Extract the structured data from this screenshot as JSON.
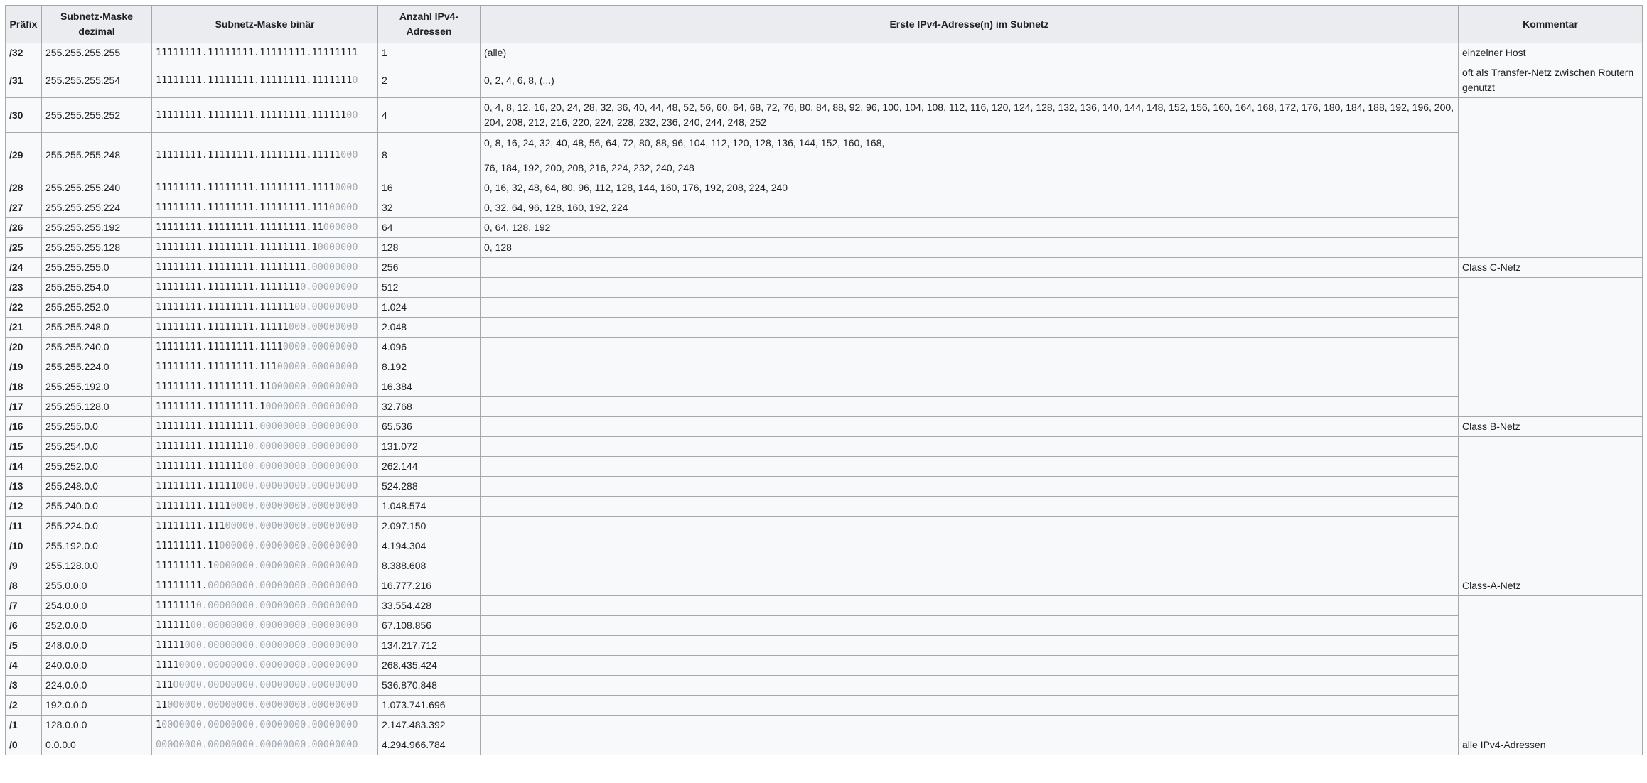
{
  "headers": {
    "prefix": "Präfix",
    "mask_dec": "Subnetz-Maske dezimal",
    "mask_bin": "Subnetz-Maske binär",
    "count": "Anzahl IPv4-Adressen",
    "first": "Erste IPv4-Adresse(n) im Subnetz",
    "comment": "Kommentar"
  },
  "rows": [
    {
      "prefix": "/32",
      "dec": "255.255.255.255",
      "ones": "11111111.11111111.11111111.11111111",
      "zeros": "",
      "count": "1",
      "first": "(alle)",
      "first2": "",
      "comment": "einzelner Host"
    },
    {
      "prefix": "/31",
      "dec": "255.255.255.254",
      "ones": "11111111.11111111.11111111.1111111",
      "zeros": "0",
      "count": "2",
      "first": "0, 2, 4, 6, 8, (...)",
      "first2": "",
      "comment": "oft als Transfer-Netz zwischen Routern genutzt"
    },
    {
      "prefix": "/30",
      "dec": "255.255.255.252",
      "ones": "11111111.11111111.11111111.111111",
      "zeros": "00",
      "count": "4",
      "first": "0, 4, 8, 12, 16, 20, 24, 28, 32, 36, 40, 44, 48, 52, 56, 60, 64, 68, 72, 76, 80, 84, 88, 92, 96, 100, 104, 108, 112, 116, 120, 124, 128, 132, 136, 140, 144, 148, 152, 156, 160, 164, 168, 172, 176, 180, 184, 188, 192, 196, 200, 204, 208, 212, 216, 220, 224, 228, 232, 236, 240, 244, 248, 252",
      "first2": "",
      "comment": ""
    },
    {
      "prefix": "/29",
      "dec": "255.255.255.248",
      "ones": "11111111.11111111.11111111.11111",
      "zeros": "000",
      "count": "8",
      "first": "0, 8, 16, 24, 32, 40, 48, 56, 64, 72, 80, 88, 96, 104, 112, 120, 128, 136, 144, 152, 160, 168,",
      "first2": "76, 184, 192, 200, 208, 216, 224, 232, 240, 248",
      "comment": ""
    },
    {
      "prefix": "/28",
      "dec": "255.255.255.240",
      "ones": "11111111.11111111.11111111.1111",
      "zeros": "0000",
      "count": "16",
      "first": "0, 16, 32, 48, 64, 80, 96, 112, 128, 144, 160, 176, 192, 208, 224, 240",
      "first2": "",
      "comment": ""
    },
    {
      "prefix": "/27",
      "dec": "255.255.255.224",
      "ones": "11111111.11111111.11111111.111",
      "zeros": "00000",
      "count": "32",
      "first": "0, 32, 64, 96, 128, 160, 192, 224",
      "first2": "",
      "comment": ""
    },
    {
      "prefix": "/26",
      "dec": "255.255.255.192",
      "ones": "11111111.11111111.11111111.11",
      "zeros": "000000",
      "count": "64",
      "first": "0, 64, 128, 192",
      "first2": "",
      "comment": ""
    },
    {
      "prefix": "/25",
      "dec": "255.255.255.128",
      "ones": "11111111.11111111.11111111.1",
      "zeros": "0000000",
      "count": "128",
      "first": "0, 128",
      "first2": "",
      "comment": ""
    },
    {
      "prefix": "/24",
      "dec": "255.255.255.0",
      "ones": "11111111.11111111.11111111.",
      "zeros": "00000000",
      "count": "256",
      "first": "",
      "first2": "",
      "comment": "Class C-Netz"
    },
    {
      "prefix": "/23",
      "dec": "255.255.254.0",
      "ones": "11111111.11111111.1111111",
      "zeros": "0.00000000",
      "count": "512",
      "first": "",
      "first2": "",
      "comment": ""
    },
    {
      "prefix": "/22",
      "dec": "255.255.252.0",
      "ones": "11111111.11111111.111111",
      "zeros": "00.00000000",
      "count": "1.024",
      "first": "",
      "first2": "",
      "comment": ""
    },
    {
      "prefix": "/21",
      "dec": "255.255.248.0",
      "ones": "11111111.11111111.11111",
      "zeros": "000.00000000",
      "count": "2.048",
      "first": "",
      "first2": "",
      "comment": ""
    },
    {
      "prefix": "/20",
      "dec": "255.255.240.0",
      "ones": "11111111.11111111.1111",
      "zeros": "0000.00000000",
      "count": "4.096",
      "first": "",
      "first2": "",
      "comment": ""
    },
    {
      "prefix": "/19",
      "dec": "255.255.224.0",
      "ones": "11111111.11111111.111",
      "zeros": "00000.00000000",
      "count": "8.192",
      "first": "",
      "first2": "",
      "comment": ""
    },
    {
      "prefix": "/18",
      "dec": "255.255.192.0",
      "ones": "11111111.11111111.11",
      "zeros": "000000.00000000",
      "count": "16.384",
      "first": "",
      "first2": "",
      "comment": ""
    },
    {
      "prefix": "/17",
      "dec": "255.255.128.0",
      "ones": "11111111.11111111.1",
      "zeros": "0000000.00000000",
      "count": "32.768",
      "first": "",
      "first2": "",
      "comment": ""
    },
    {
      "prefix": "/16",
      "dec": "255.255.0.0",
      "ones": "11111111.11111111.",
      "zeros": "00000000.00000000",
      "count": "65.536",
      "first": "",
      "first2": "",
      "comment": "Class B-Netz"
    },
    {
      "prefix": "/15",
      "dec": "255.254.0.0",
      "ones": "11111111.1111111",
      "zeros": "0.00000000.00000000",
      "count": "131.072",
      "first": "",
      "first2": "",
      "comment": ""
    },
    {
      "prefix": "/14",
      "dec": "255.252.0.0",
      "ones": "11111111.111111",
      "zeros": "00.00000000.00000000",
      "count": "262.144",
      "first": "",
      "first2": "",
      "comment": ""
    },
    {
      "prefix": "/13",
      "dec": "255.248.0.0",
      "ones": "11111111.11111",
      "zeros": "000.00000000.00000000",
      "count": "524.288",
      "first": "",
      "first2": "",
      "comment": ""
    },
    {
      "prefix": "/12",
      "dec": "255.240.0.0",
      "ones": "11111111.1111",
      "zeros": "0000.00000000.00000000",
      "count": "1.048.574",
      "first": "",
      "first2": "",
      "comment": ""
    },
    {
      "prefix": "/11",
      "dec": "255.224.0.0",
      "ones": "11111111.111",
      "zeros": "00000.00000000.00000000",
      "count": "2.097.150",
      "first": "",
      "first2": "",
      "comment": ""
    },
    {
      "prefix": "/10",
      "dec": "255.192.0.0",
      "ones": "11111111.11",
      "zeros": "000000.00000000.00000000",
      "count": "4.194.304",
      "first": "",
      "first2": "",
      "comment": ""
    },
    {
      "prefix": "/9",
      "dec": "255.128.0.0",
      "ones": "11111111.1",
      "zeros": "0000000.00000000.00000000",
      "count": "8.388.608",
      "first": "",
      "first2": "",
      "comment": ""
    },
    {
      "prefix": "/8",
      "dec": "255.0.0.0",
      "ones": "11111111.",
      "zeros": "00000000.00000000.00000000",
      "count": "16.777.216",
      "first": "",
      "first2": "",
      "comment": "Class-A-Netz"
    },
    {
      "prefix": "/7",
      "dec": "254.0.0.0",
      "ones": "1111111",
      "zeros": "0.00000000.00000000.00000000",
      "count": "33.554.428",
      "first": "",
      "first2": "",
      "comment": ""
    },
    {
      "prefix": "/6",
      "dec": "252.0.0.0",
      "ones": "111111",
      "zeros": "00.00000000.00000000.00000000",
      "count": "67.108.856",
      "first": "",
      "first2": "",
      "comment": ""
    },
    {
      "prefix": "/5",
      "dec": "248.0.0.0",
      "ones": "11111",
      "zeros": "000.00000000.00000000.00000000",
      "count": "134.217.712",
      "first": "",
      "first2": "",
      "comment": ""
    },
    {
      "prefix": "/4",
      "dec": "240.0.0.0",
      "ones": "1111",
      "zeros": "0000.00000000.00000000.00000000",
      "count": "268.435.424",
      "first": "",
      "first2": "",
      "comment": ""
    },
    {
      "prefix": "/3",
      "dec": "224.0.0.0",
      "ones": "111",
      "zeros": "00000.00000000.00000000.00000000",
      "count": "536.870.848",
      "first": "",
      "first2": "",
      "comment": ""
    },
    {
      "prefix": "/2",
      "dec": "192.0.0.0",
      "ones": "11",
      "zeros": "000000.00000000.00000000.00000000",
      "count": "1.073.741.696",
      "first": "",
      "first2": "",
      "comment": ""
    },
    {
      "prefix": "/1",
      "dec": "128.0.0.0",
      "ones": "1",
      "zeros": "0000000.00000000.00000000.00000000",
      "count": "2.147.483.392",
      "first": "",
      "first2": "",
      "comment": ""
    },
    {
      "prefix": "/0",
      "dec": "0.0.0.0",
      "ones": "",
      "zeros": "00000000.00000000.00000000.00000000",
      "count": "4.294.966.784",
      "first": "",
      "first2": "",
      "comment": "alle IPv4-Adressen"
    }
  ]
}
